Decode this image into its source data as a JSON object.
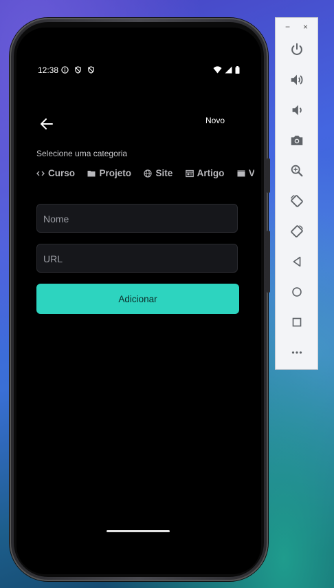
{
  "status_bar": {
    "time": "12:38"
  },
  "header": {
    "title": "Novo"
  },
  "category": {
    "label": "Selecione uma categoria",
    "chips": [
      {
        "label": "Curso",
        "icon": "code-icon"
      },
      {
        "label": "Projeto",
        "icon": "folder-icon"
      },
      {
        "label": "Site",
        "icon": "globe-icon"
      },
      {
        "label": "Artigo",
        "icon": "article-icon"
      },
      {
        "label": "Víde",
        "icon": "movie-icon"
      }
    ]
  },
  "form": {
    "name_placeholder": "Nome",
    "url_placeholder": "URL",
    "submit_label": "Adicionar"
  },
  "emulator_panel": {
    "minimize": "−",
    "close": "×",
    "buttons": [
      "power-icon",
      "volume-up-icon",
      "volume-down-icon",
      "camera-icon",
      "zoom-icon",
      "rotate-left-icon",
      "rotate-right-icon",
      "back-icon",
      "home-icon",
      "overview-icon",
      "more-icon"
    ]
  },
  "colors": {
    "accent": "#2dd4bf",
    "background": "#000000"
  }
}
